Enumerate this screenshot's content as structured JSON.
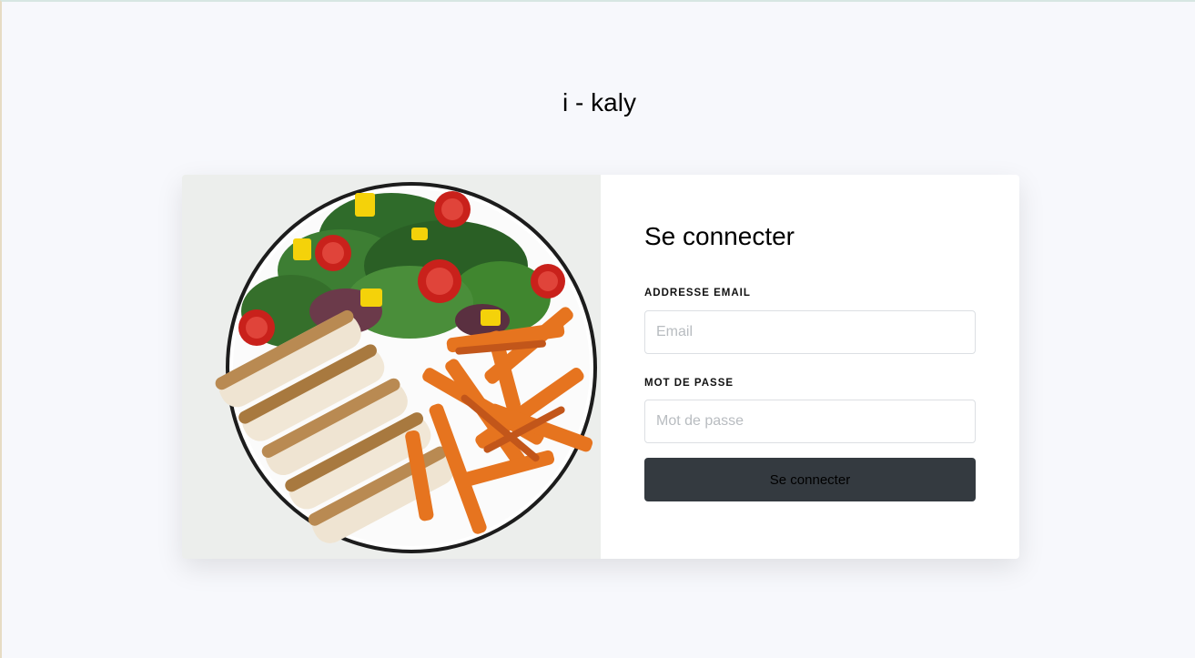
{
  "app": {
    "title": "i - kaly"
  },
  "login": {
    "title": "Se connecter",
    "email_label": "ADDRESSE EMAIL",
    "email_placeholder": "Email",
    "email_value": "",
    "password_label": "MOT DE PASSE",
    "password_placeholder": "Mot de passe",
    "password_value": "",
    "submit_label": "Se connecter"
  },
  "colors": {
    "page_background": "#f7f8fc",
    "card_background": "#ffffff",
    "button_background": "#343a40"
  },
  "image": {
    "subject": "plate-of-chicken-salad-and-sweet-potato-fries"
  }
}
